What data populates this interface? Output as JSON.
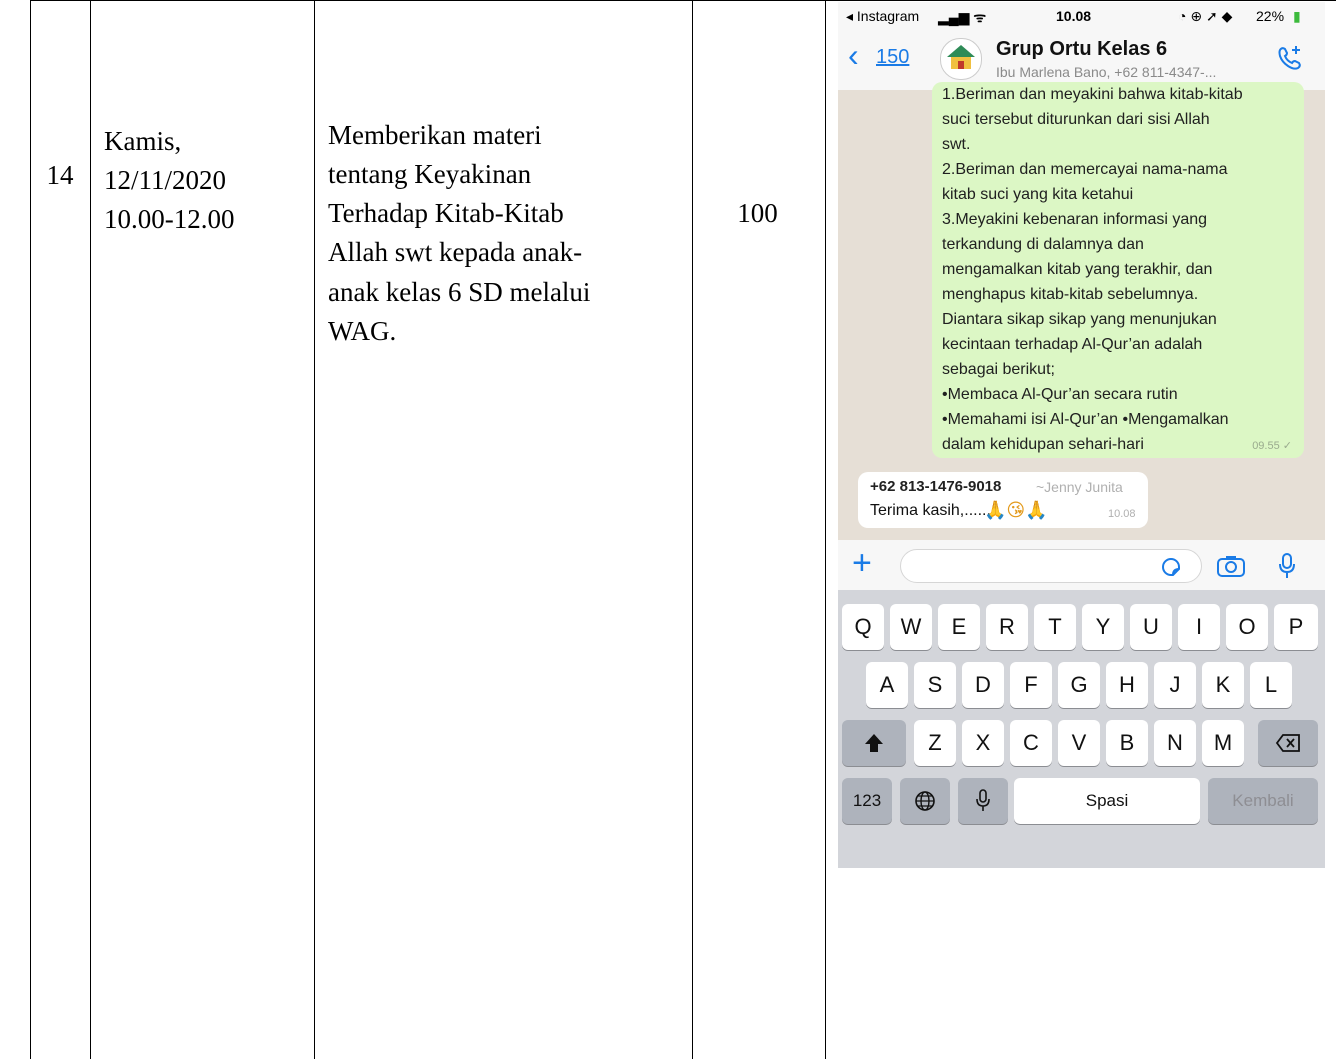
{
  "table": {
    "row_no": "14",
    "date_text": "Kamis,\n 12/11/2020\n10.00-12.00",
    "activity_text": "Memberikan materi\ntentang Keyakinan\nTerhadap Kitab-Kitab\nAllah swt kepada anak-\nanak kelas 6 SD melalui\nWAG.",
    "score": "100"
  },
  "phone": {
    "status": {
      "back_app": "◂ Instagram",
      "time": "10.08",
      "battery": "22%"
    },
    "header": {
      "back_count": "150",
      "group_name": "Grup Ortu Kelas 6",
      "members": "Ibu Marlena Bano, +62 811-4347-..."
    },
    "outgoing": {
      "text": "1.Beriman dan meyakini bahwa kitab-kitab\nsuci tersebut diturunkan dari sisi Allah\nswt.\n2.Beriman dan memercayai nama-nama\nkitab suci yang kita ketahui\n 3.Meyakini kebenaran informasi yang\nterkandung di dalamnya dan\nmengamalkan kitab yang terakhir, dan\nmenghapus kitab-kitab sebelumnya.\nDiantara sikap sikap yang menunjukan\nkecintaan terhadap Al-Qur’an adalah\nsebagai berikut;\n•Membaca Al-Qur’an secara rutin\n•Memahami isi Al-Qur’an •Mengamalkan\ndalam kehidupan sehari-hari",
      "time": "09.55 ✓"
    },
    "incoming": {
      "sender": "+62 813-1476-9018",
      "sender_alias": "~Jenny Junita",
      "text": "Terima kasih,......",
      "emoji": "🙏😘🙏",
      "time": "10.08"
    },
    "keyboard": {
      "row1": [
        "Q",
        "W",
        "E",
        "R",
        "T",
        "Y",
        "U",
        "I",
        "O",
        "P"
      ],
      "row2": [
        "A",
        "S",
        "D",
        "F",
        "G",
        "H",
        "J",
        "K",
        "L"
      ],
      "row3": [
        "Z",
        "X",
        "C",
        "V",
        "B",
        "N",
        "M"
      ],
      "numbers_key": "123",
      "space_key": "Spasi",
      "return_key": "Kembali"
    },
    "colors": {
      "accent": "#1a7be6",
      "outgoing_bubble": "#dcf7c5",
      "chat_bg": "#e6dfd6"
    },
    "icons": [
      "call-add-icon",
      "plus-icon",
      "sticker-icon",
      "camera-icon",
      "mic-icon",
      "shift-icon",
      "backspace-icon",
      "globe-icon"
    ]
  }
}
